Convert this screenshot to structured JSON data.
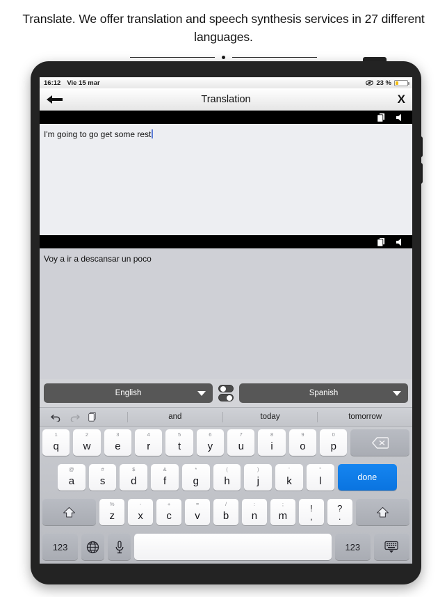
{
  "caption": {
    "text": "Translate. We offer translation and speech synthesis services in 27 different languages."
  },
  "status_bar": {
    "time": "16:12",
    "date": "Vie 15 mar",
    "battery_percent": "23 %",
    "battery_level": 23,
    "battery_color": "#f3bd10"
  },
  "app_header": {
    "title": "Translation",
    "back_label": "",
    "close_label": "X"
  },
  "source_pane": {
    "text": "I'm going to go get some rest",
    "background": "#edeef2",
    "caret_color": "#5b7bd6"
  },
  "target_pane": {
    "text": "Voy a ir a descansar un poco",
    "background": "#cfd0d6"
  },
  "language_bar": {
    "source_language": "English",
    "target_language": "Spanish"
  },
  "suggestions": {
    "words": [
      "and",
      "today",
      "tomorrow"
    ]
  },
  "keyboard": {
    "row1": [
      {
        "key": "q",
        "hint": "1"
      },
      {
        "key": "w",
        "hint": "2"
      },
      {
        "key": "e",
        "hint": "3"
      },
      {
        "key": "r",
        "hint": "4"
      },
      {
        "key": "t",
        "hint": "5"
      },
      {
        "key": "y",
        "hint": "6"
      },
      {
        "key": "u",
        "hint": "7"
      },
      {
        "key": "i",
        "hint": "8"
      },
      {
        "key": "o",
        "hint": "9"
      },
      {
        "key": "p",
        "hint": "0"
      }
    ],
    "row2": [
      {
        "key": "a",
        "hint": "@"
      },
      {
        "key": "s",
        "hint": "#"
      },
      {
        "key": "d",
        "hint": "$"
      },
      {
        "key": "f",
        "hint": "&"
      },
      {
        "key": "g",
        "hint": "*"
      },
      {
        "key": "h",
        "hint": "("
      },
      {
        "key": "j",
        "hint": ")"
      },
      {
        "key": "k",
        "hint": "'"
      },
      {
        "key": "l",
        "hint": "\""
      }
    ],
    "row3": [
      {
        "key": "z",
        "hint": "%"
      },
      {
        "key": "x",
        "hint": "-"
      },
      {
        "key": "c",
        "hint": "+"
      },
      {
        "key": "v",
        "hint": "="
      },
      {
        "key": "b",
        "hint": "/"
      },
      {
        "key": "n",
        "hint": ":"
      },
      {
        "key": "m",
        "hint": ";"
      }
    ],
    "punct1": {
      "top": "!",
      "bottom": ","
    },
    "punct2": {
      "top": "?",
      "bottom": "."
    },
    "done_label": "done",
    "num_left_label": "123",
    "num_right_label": "123",
    "space_label": ""
  }
}
